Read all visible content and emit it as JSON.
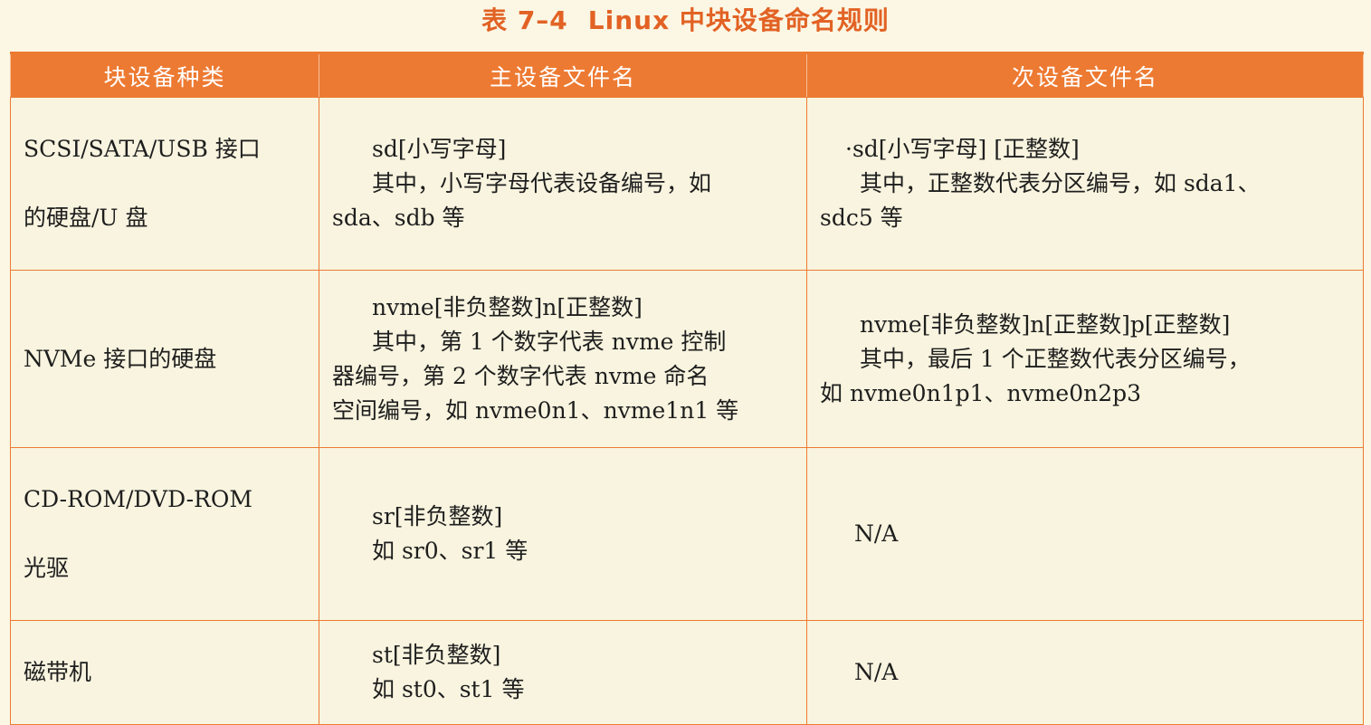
{
  "caption": {
    "number": "表 7–4",
    "title": "Linux 中块设备命名规则"
  },
  "headers": [
    "块设备种类",
    "主设备文件名",
    "次设备文件名"
  ],
  "rows": [
    {
      "category_lines": [
        "SCSI/SATA/USB 接口",
        "的硬盘/U 盘"
      ],
      "main_lines": [
        "sd[小写字母]",
        "其中，小写字母代表设备编号，如",
        "sda、sdb 等"
      ],
      "minor_lines": [
        "·sd[小写字母] [正整数]",
        "其中，正整数代表分区编号，如 sda1、",
        "sdc5 等"
      ]
    },
    {
      "category_lines": [
        "NVMe 接口的硬盘"
      ],
      "main_lines": [
        "nvme[非负整数]n[正整数]",
        "其中，第 1 个数字代表 nvme 控制",
        "器编号，第 2 个数字代表 nvme 命名",
        "空间编号，如 nvme0n1、nvme1n1 等"
      ],
      "minor_lines": [
        "nvme[非负整数]n[正整数]p[正整数]",
        "其中，最后 1 个正整数代表分区编号，",
        "如 nvme0n1p1、nvme0n2p3"
      ]
    },
    {
      "category_lines": [
        "CD-ROM/DVD-ROM",
        "光驱"
      ],
      "main_lines": [
        "sr[非负整数]",
        "如 sr0、sr1 等"
      ],
      "minor_lines": [
        "N/A"
      ]
    },
    {
      "category_lines": [
        "磁带机"
      ],
      "main_lines": [
        "st[非负整数]",
        "如 st0、st1 等"
      ],
      "minor_lines": [
        "N/A"
      ]
    }
  ],
  "colors": {
    "header_bg": "#ed7a32",
    "border": "#ed7a32",
    "caption": "#e26224",
    "page_bg": "#fbf7e4"
  }
}
